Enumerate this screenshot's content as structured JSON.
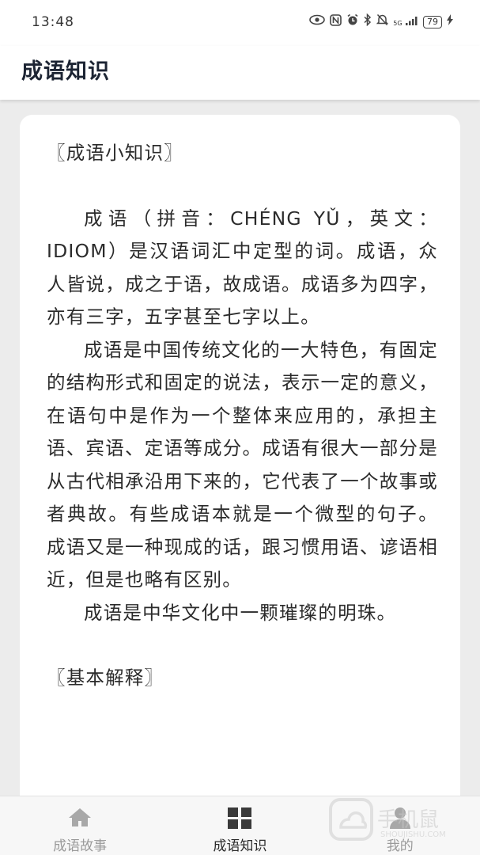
{
  "status_bar": {
    "time": "13:48",
    "battery": "79",
    "network": "5G",
    "icons": [
      "eye-icon",
      "nfc-icon",
      "alarm-icon",
      "bluetooth-icon",
      "mute-icon",
      "signal-icon",
      "battery-icon",
      "charging-icon"
    ]
  },
  "app_bar": {
    "title": "成语知识"
  },
  "content": {
    "section1_title": "〖成语小知识〗",
    "paragraphs": [
      "成语（拼音：CHÉNG YǓ，英文：IDIOM）是汉语词汇中定型的词。成语，众人皆说，成之于语，故成语。成语多为四字，亦有三字，五字甚至七字以上。",
      "成语是中国传统文化的一大特色，有固定的结构形式和固定的说法，表示一定的意义，在语句中是作为一个整体来应用的，承担主语、宾语、定语等成分。成语有很大一部分是从古代相承沿用下来的，它代表了一个故事或者典故。有些成语本就是一个微型的句子。 成语又是一种现成的话，跟习惯用语、谚语相近，但是也略有区别。",
      "成语是中华文化中一颗璀璨的明珠。"
    ],
    "section2_title": "〖基本解释〗"
  },
  "bottom_nav": {
    "items": [
      {
        "label": "成语故事",
        "icon": "home-icon",
        "active": false
      },
      {
        "label": "成语知识",
        "icon": "grid-icon",
        "active": true
      },
      {
        "label": "我的",
        "icon": "person-icon",
        "active": false
      }
    ]
  },
  "watermark": {
    "text": "手机鼠",
    "url": "SHOUJISHU.COM"
  },
  "colors": {
    "background": "#ececec",
    "card": "#ffffff",
    "title_text": "#1c2433",
    "body_text": "#2b2b2b",
    "nav_inactive": "#9a9a9a",
    "nav_active": "#2b2b2b"
  }
}
